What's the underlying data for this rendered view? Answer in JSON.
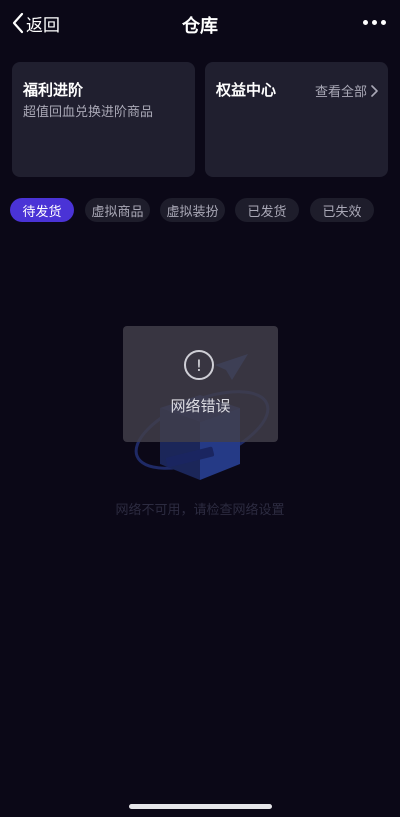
{
  "nav": {
    "back_label": "返回",
    "title": "仓库",
    "more_icon": "more-horizontal-icon"
  },
  "cards": {
    "welfare": {
      "title": "福利进阶",
      "subtitle": "超值回血兑换进阶商品"
    },
    "rights": {
      "title": "权益中心",
      "view_all": "查看全部"
    }
  },
  "tabs": [
    {
      "label": "待发货",
      "active": true
    },
    {
      "label": "虚拟商品",
      "active": false
    },
    {
      "label": "虚拟装扮",
      "active": false
    },
    {
      "label": "已发货",
      "active": false
    },
    {
      "label": "已失效",
      "active": false
    }
  ],
  "empty_state": {
    "message": "网络不可用，请检查网络设置"
  },
  "toast": {
    "icon": "exclamation-icon",
    "symbol": "!",
    "message": "网络错误"
  },
  "colors": {
    "background": "#0b0817",
    "card": "#201f2f",
    "tab_active": "#4a33d6",
    "tab_inactive": "#1e1d2b"
  }
}
